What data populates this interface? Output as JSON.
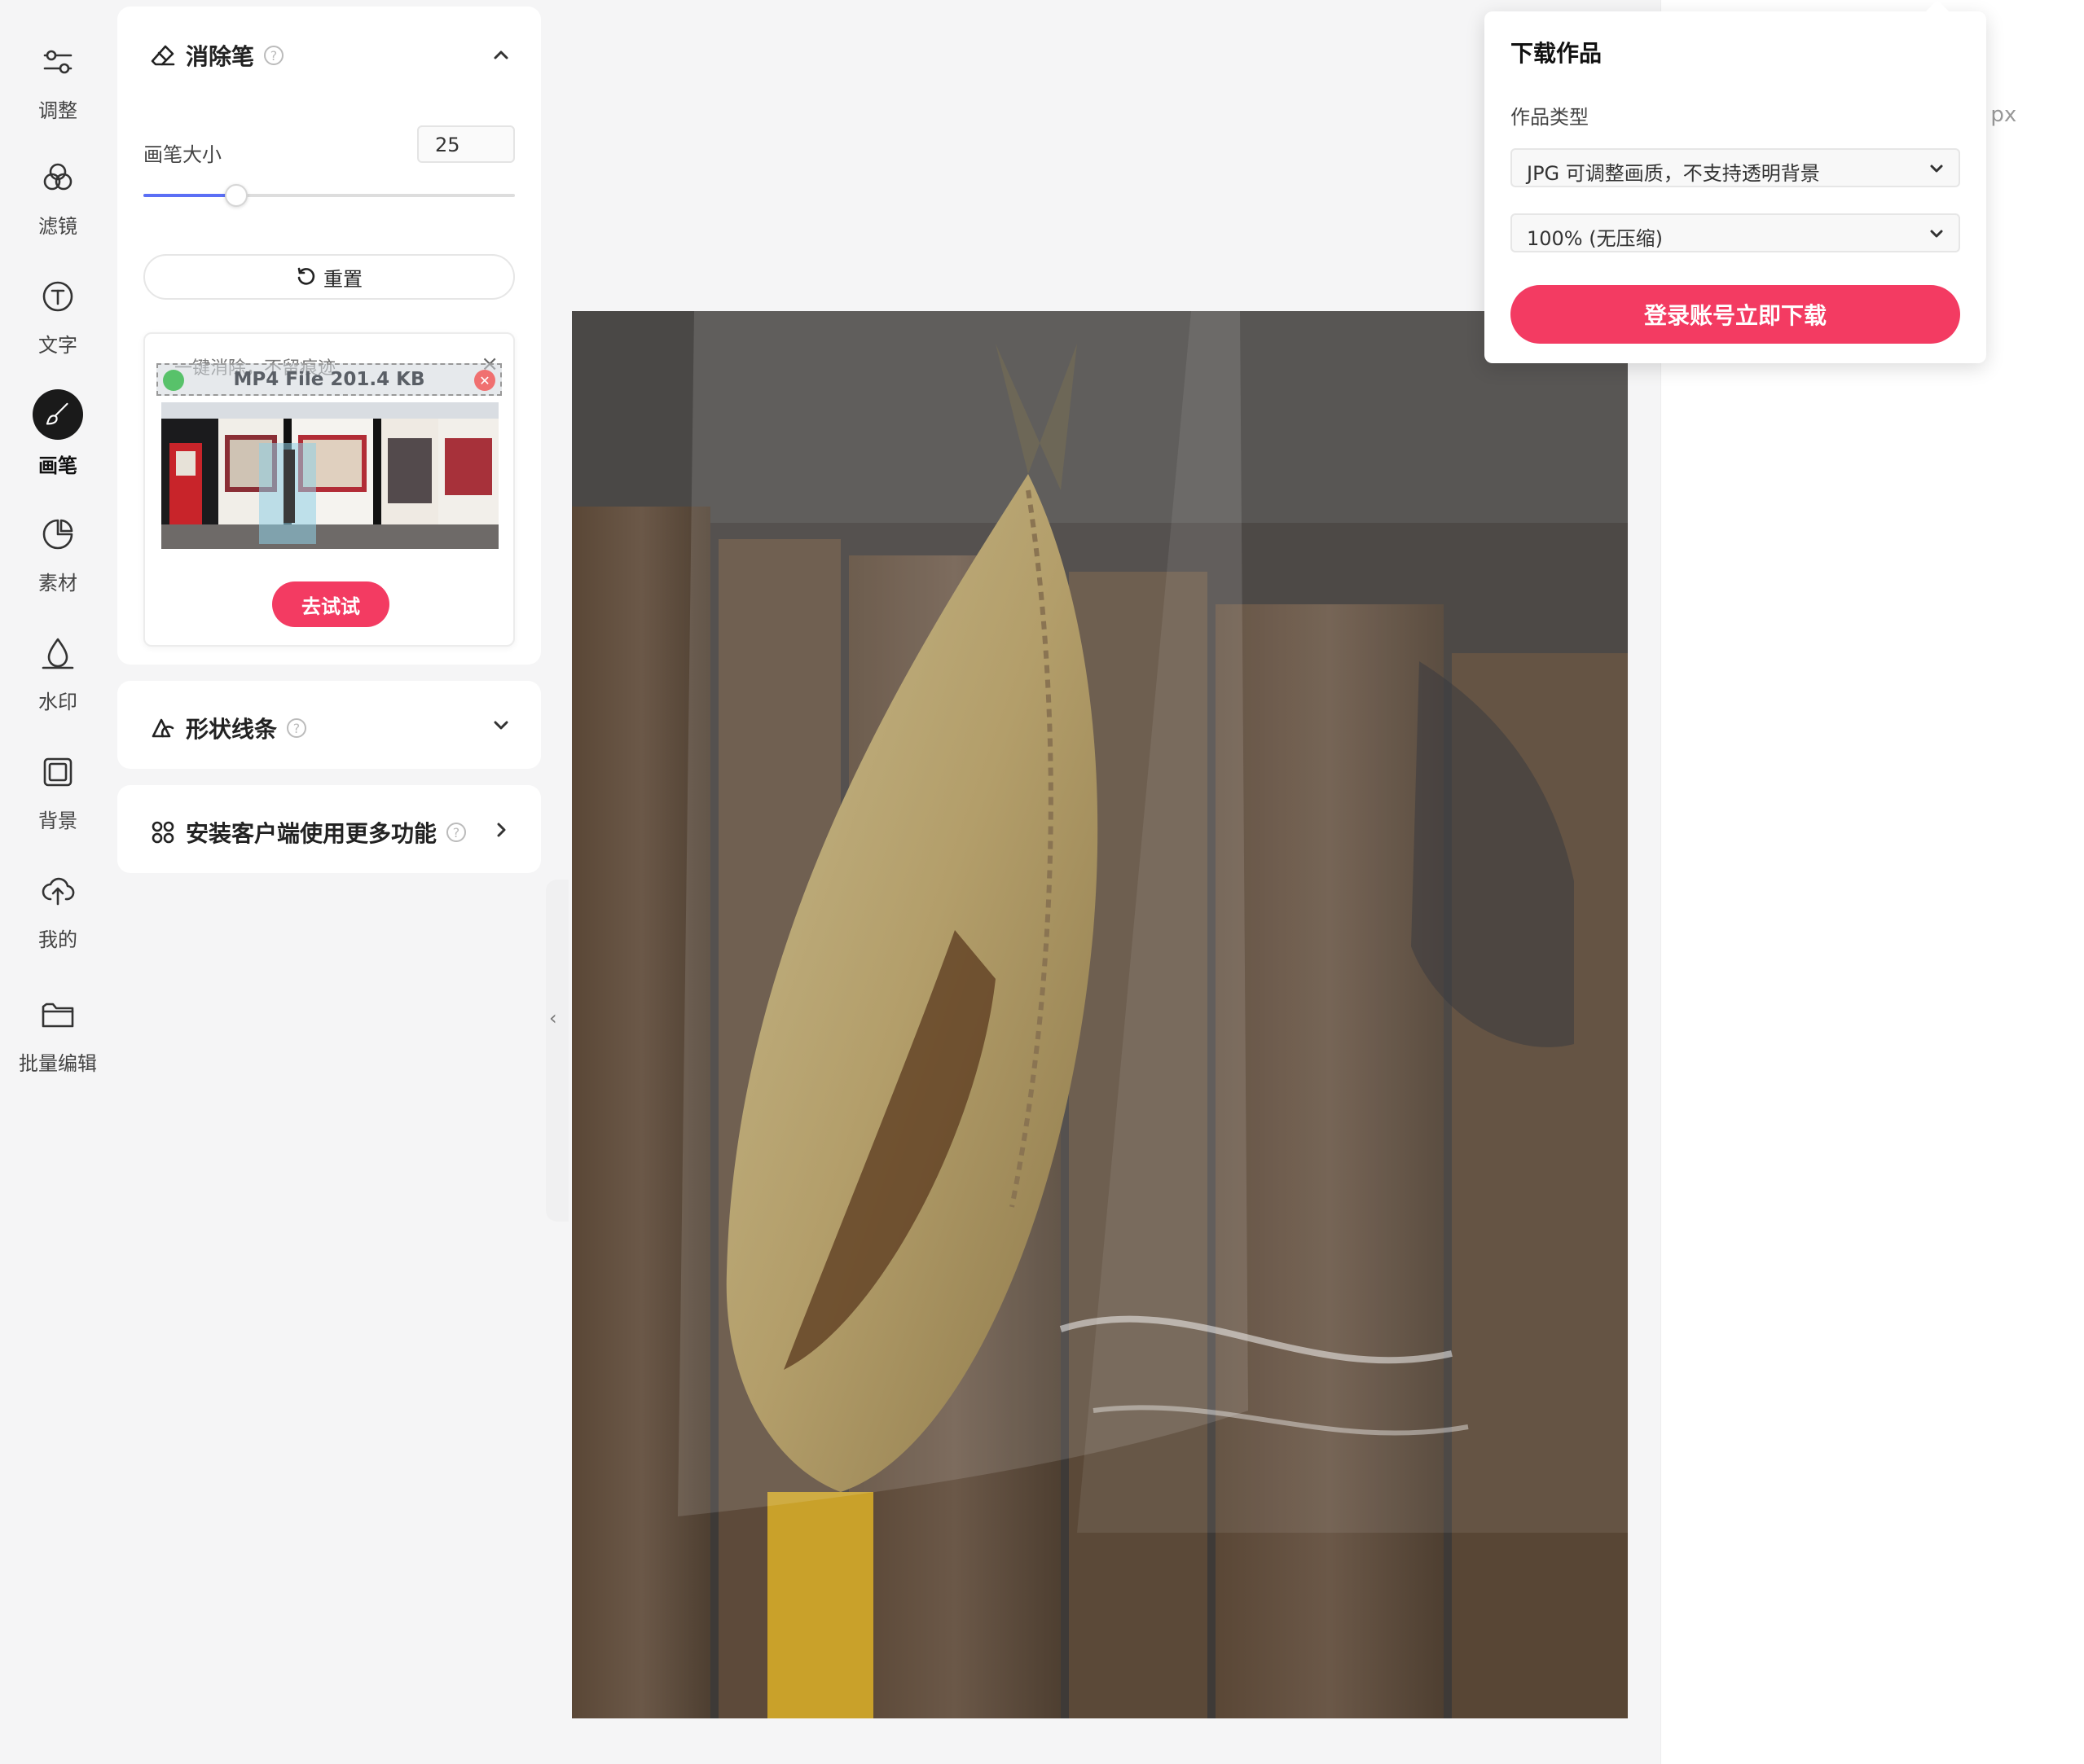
{
  "sidebar": {
    "items": [
      {
        "label": "调整",
        "icon": "sliders-icon"
      },
      {
        "label": "滤镜",
        "icon": "filter-icon"
      },
      {
        "label": "文字",
        "icon": "text-icon"
      },
      {
        "label": "画笔",
        "icon": "brush-icon",
        "active": true
      },
      {
        "label": "素材",
        "icon": "sticker-icon"
      },
      {
        "label": "水印",
        "icon": "watermark-icon"
      },
      {
        "label": "背景",
        "icon": "background-icon"
      },
      {
        "label": "我的",
        "icon": "cloud-upload-icon"
      },
      {
        "label": "批量编辑",
        "icon": "folder-icon"
      }
    ]
  },
  "eraser": {
    "title": "消除笔",
    "help": "?",
    "brush_size_label": "画笔大小",
    "brush_size_value": "25",
    "brush_size_fraction": 0.25,
    "reset_label": "重置",
    "promo": {
      "title": "一键消除，不留痕迹",
      "file_label": "MP4 File 201.4 KB",
      "close": "×",
      "try_label": "去试试"
    }
  },
  "shape": {
    "title": "形状线条",
    "help": "?"
  },
  "install": {
    "title": "安装客户端使用更多功能",
    "help": "?"
  },
  "collapse": {
    "glyph": "‹"
  },
  "right_panel": {
    "fragment": ") px"
  },
  "download": {
    "title": "下载作品",
    "type_label": "作品类型",
    "type_value": "JPG 可调整画质，不支持透明背景",
    "quality_value": "100% (无压缩)",
    "button_label": "登录账号立即下载"
  },
  "colors": {
    "accent": "#f33b62",
    "slider": "#5b6ff5",
    "panel": "#ffffff",
    "background": "#f5f5f6"
  }
}
